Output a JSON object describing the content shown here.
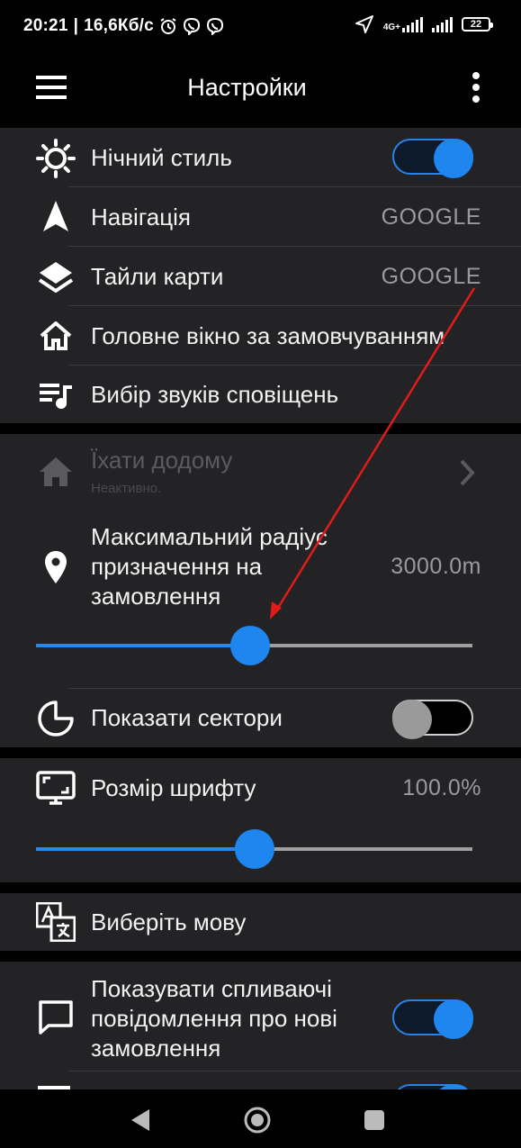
{
  "status_bar": {
    "time": "20:21",
    "speed": "16,6Кб/с",
    "network": "4G+",
    "battery": "22"
  },
  "app_bar": {
    "title": "Настройки"
  },
  "settings": {
    "night_style": {
      "label": "Нічний стиль",
      "enabled": true
    },
    "navigation": {
      "label": "Навігація",
      "value": "GOOGLE"
    },
    "map_tiles": {
      "label": "Тайли карти",
      "value": "GOOGLE"
    },
    "main_window": {
      "label": "Головне вікно за замовчуванням"
    },
    "sounds": {
      "label": "Вибір звуків сповіщень"
    },
    "go_home": {
      "label": "Їхати додому",
      "sublabel": "Неактивно."
    },
    "max_radius": {
      "label_lines": [
        "Максимальний радіус",
        "призначення на",
        "замовлення"
      ],
      "value": "3000.0m",
      "slider_fraction": 0.49
    },
    "show_sectors": {
      "label": "Показати сектори",
      "enabled": false
    },
    "font_size": {
      "label": "Розмір шрифту",
      "value": "100.0%",
      "slider_fraction": 0.5
    },
    "language": {
      "label": "Виберіть мову"
    },
    "popup_notifications": {
      "label_lines": [
        "Показувати спливаючі",
        "повідомлення про нові",
        "замовлення"
      ],
      "enabled": true
    }
  },
  "colors": {
    "accent": "#1f86f0",
    "card": "#232325",
    "annotation_arrow": "#e01b1b"
  }
}
